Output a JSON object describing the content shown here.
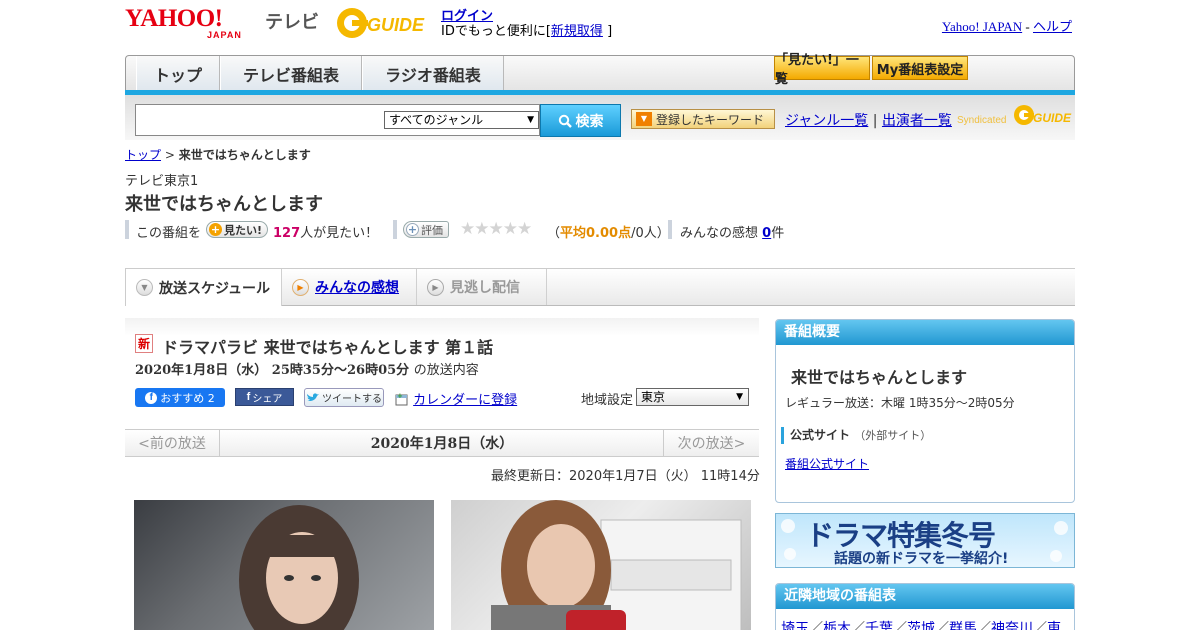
{
  "header": {
    "logo_main": "YAHOO!",
    "logo_sub": "JAPAN",
    "service_label": "テレビ",
    "gguide_logo": "G-GUIDE",
    "login_link": "ログイン",
    "id_prefix": "IDでもっと便利に[",
    "signup_link": "新規取得",
    "id_suffix": "]",
    "yahoo_japan_link": "Yahoo! JAPAN",
    "separator": "-",
    "help_link": "ヘルプ"
  },
  "nav": {
    "tabs": [
      {
        "label": "トップ"
      },
      {
        "label": "テレビ番組表"
      },
      {
        "label": "ラジオ番組表"
      }
    ],
    "mitai_list_button": "「見たい!」一覧",
    "my_schedule_button": "My番組表設定"
  },
  "search": {
    "query_value": "",
    "genre_selected": "すべてのジャンル",
    "search_button": "検索",
    "keyword_button": "登録したキーワード",
    "genre_list_link": "ジャンル一覧",
    "link_separator": "|",
    "performer_list_link": "出演者一覧",
    "syndicated_label": "Syndicated"
  },
  "breadcrumb": {
    "top_link": "トップ",
    "separator": ">",
    "current": "来世ではちゃんとします"
  },
  "program": {
    "channel": "テレビ東京1",
    "title": "来世ではちゃんとします",
    "this_program_prefix": "この番組を",
    "mitai_button": "見たい!",
    "mitai_count": "127",
    "mitai_suffix": "人が見たい！",
    "rate_button": "評価",
    "stars": 0,
    "avg_open": "（",
    "avg_label": "平均0.00点",
    "avg_count": "/0人）",
    "comments_prefix": "みんなの感想",
    "comments_count": "0",
    "comments_suffix": "件"
  },
  "page_tabs": [
    {
      "label": "放送スケジュール"
    },
    {
      "label": "みんなの感想"
    },
    {
      "label": "見逃し配信"
    }
  ],
  "episode": {
    "new_badge": "新",
    "title": "ドラマパラビ 来世ではちゃんとします 第１話",
    "date_time": "2020年1月8日（水） 25時35分～26時05分",
    "date_suffix": "の放送内容",
    "fb_like": "おすすめ 2",
    "fb_share": "シェア",
    "tweet": "ツイートする",
    "calendar_link": "カレンダーに登録",
    "region_label": "地域設定",
    "region_value": "東京"
  },
  "date_nav": {
    "prev": "<前の放送",
    "current": "2020年1月8日（水）",
    "next": "次の放送>"
  },
  "updated": "最終更新日：2020年1月7日（火） 11時14分",
  "sidebar": {
    "summary_heading": "番組概要",
    "program_name": "来世ではちゃんとします",
    "regular_broadcast": "レギュラー放送：木曜 1時35分～2時05分",
    "official_heading": "公式サイト",
    "official_note": "（外部サイト）",
    "official_link": "番組公式サイト",
    "banner_title": "ドラマ特集冬号",
    "banner_sub": "話題の新ドラマを一挙紹介!",
    "nearby_heading": "近隣地域の番組表",
    "nearby_regions": [
      "埼玉",
      "栃木",
      "千葉",
      "茨城",
      "群馬",
      "神奈川",
      "東"
    ],
    "region_separator": "／"
  },
  "colors": {
    "accent_blue": "#1ea7e1",
    "yahoo_red": "#e60012",
    "orange": "#f4a900",
    "link": "#0000cc",
    "count_red": "#cc0066",
    "avg_orange": "#e38b00"
  }
}
